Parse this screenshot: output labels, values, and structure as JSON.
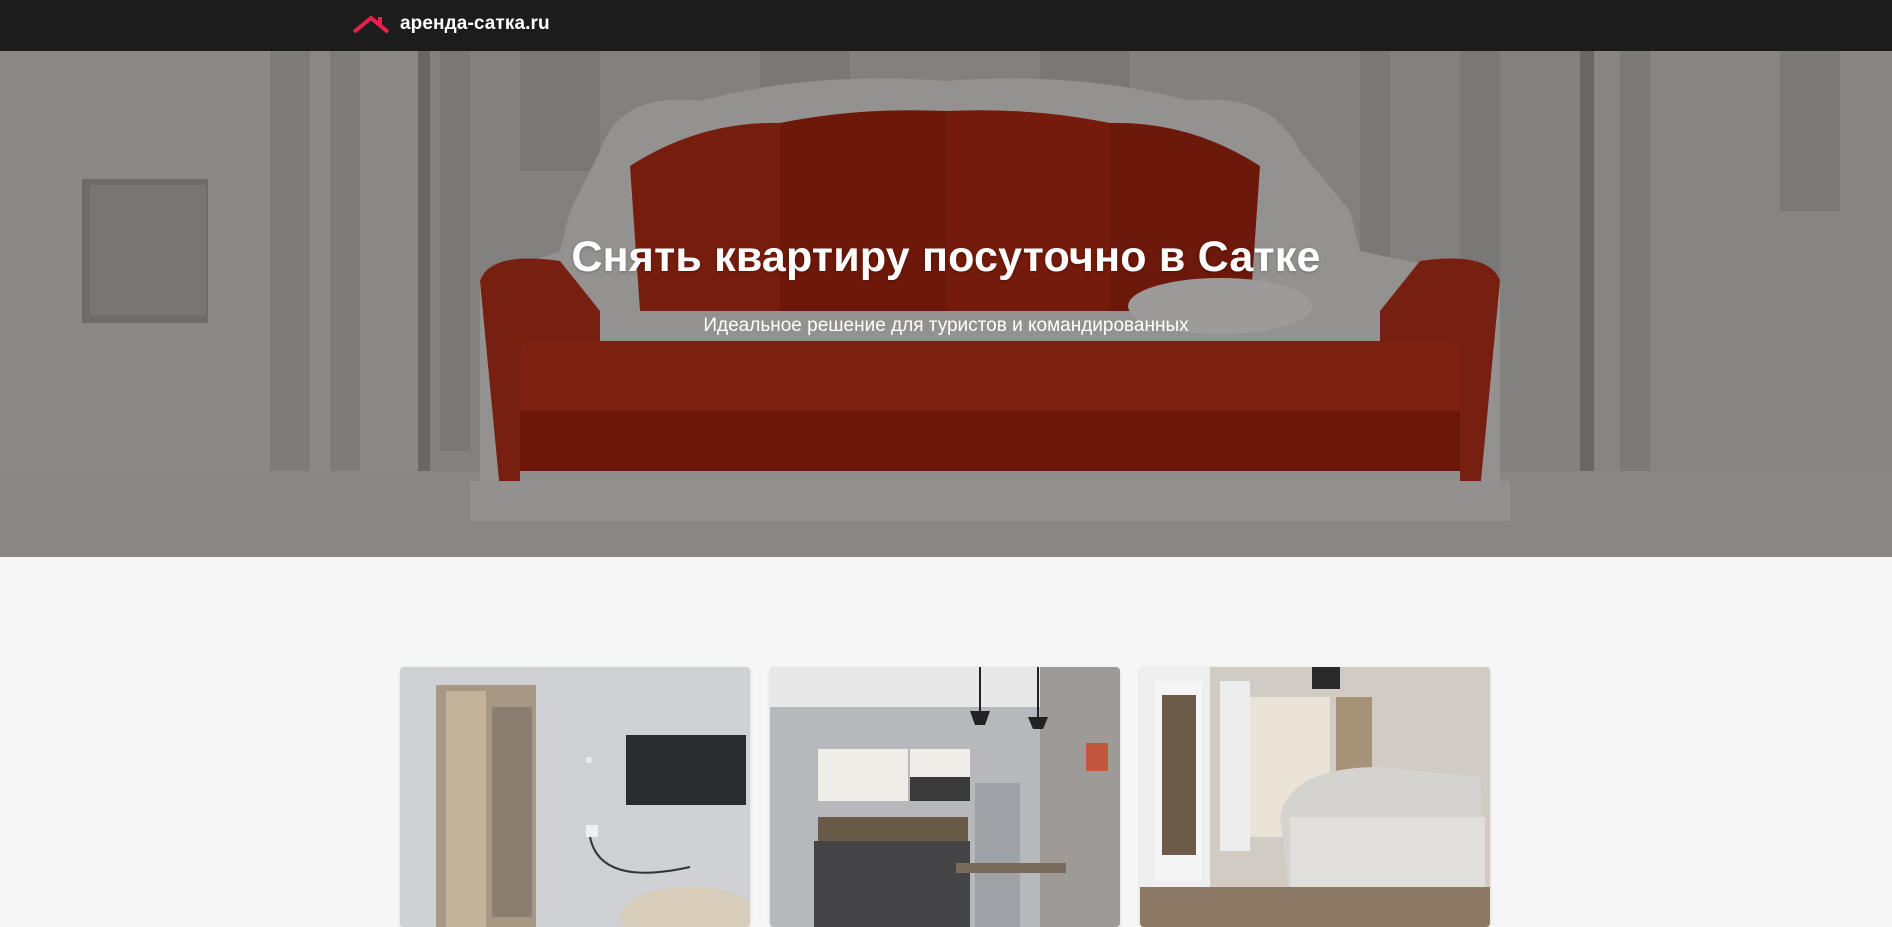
{
  "header": {
    "logo_text": "аренда-сатка.ru",
    "logo_icon": "roof-icon",
    "accent_color": "#e8214a"
  },
  "hero": {
    "title": "Снять квартиру посуточно в Сатке",
    "subtitle": "Идеальное решение для туристов и командированных"
  },
  "listings": [
    {
      "photo": "apartment-photo-room-with-tv"
    },
    {
      "photo": "apartment-photo-kitchen"
    },
    {
      "photo": "apartment-photo-living-room-sofa"
    }
  ]
}
